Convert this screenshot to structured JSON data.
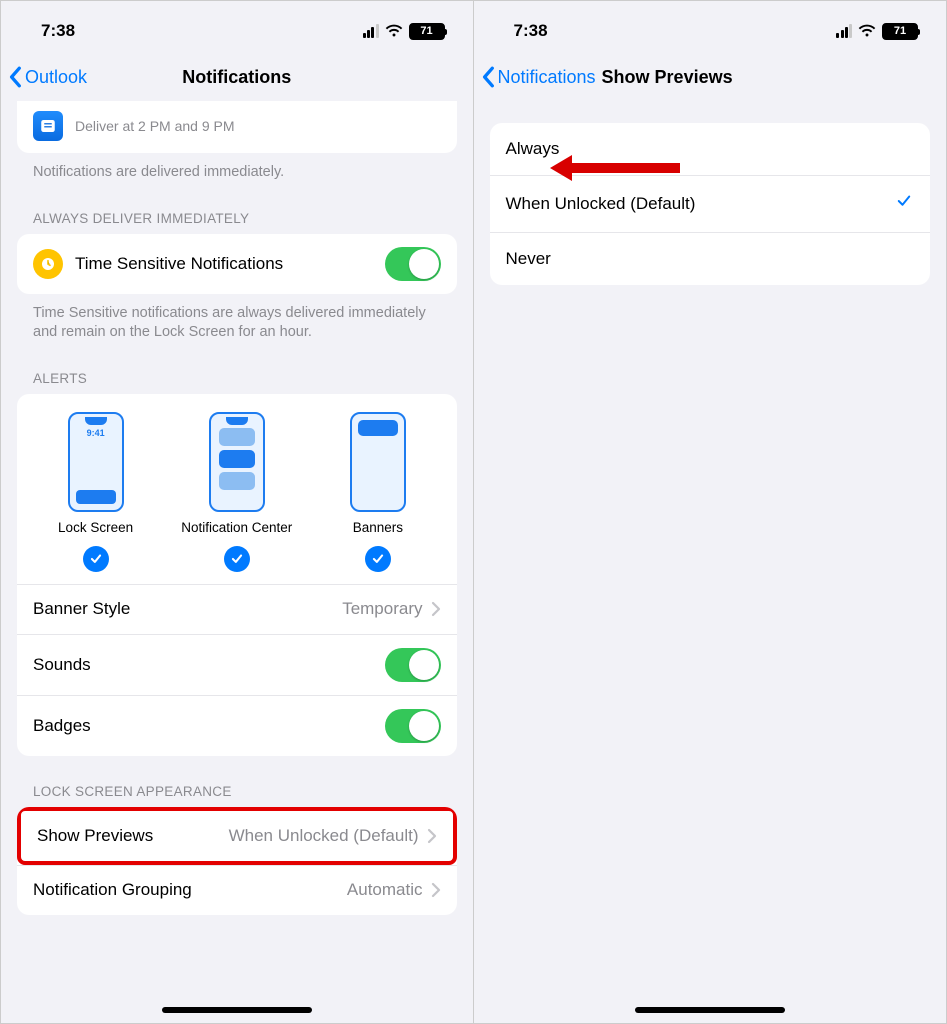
{
  "status": {
    "time": "7:38",
    "battery": "71"
  },
  "left": {
    "back_label": "Outlook",
    "title": "Notifications",
    "schedule_sub": "Deliver at 2 PM and 9 PM",
    "delivered_note": "Notifications are delivered immediately.",
    "sections": {
      "deliver_header": "ALWAYS DELIVER IMMEDIATELY",
      "alerts_header": "ALERTS",
      "lockscreen_header": "LOCK SCREEN APPEARANCE"
    },
    "rows": {
      "time_sensitive": "Time Sensitive Notifications",
      "time_sensitive_note": "Time Sensitive notifications are always delivered immediately and remain on the Lock Screen for an hour.",
      "banner_style": "Banner Style",
      "banner_style_value": "Temporary",
      "sounds": "Sounds",
      "badges": "Badges",
      "show_previews": "Show Previews",
      "show_previews_value": "When Unlocked (Default)",
      "notification_grouping": "Notification Grouping",
      "notification_grouping_value": "Automatic"
    },
    "alerts": {
      "lock_screen": "Lock Screen",
      "notification_center": "Notification Center",
      "banners": "Banners",
      "mock_time": "9:41"
    }
  },
  "right": {
    "back_label": "Notifications",
    "title": "Show Previews",
    "options": {
      "always": "Always",
      "when_unlocked": "When Unlocked (Default)",
      "never": "Never"
    }
  }
}
